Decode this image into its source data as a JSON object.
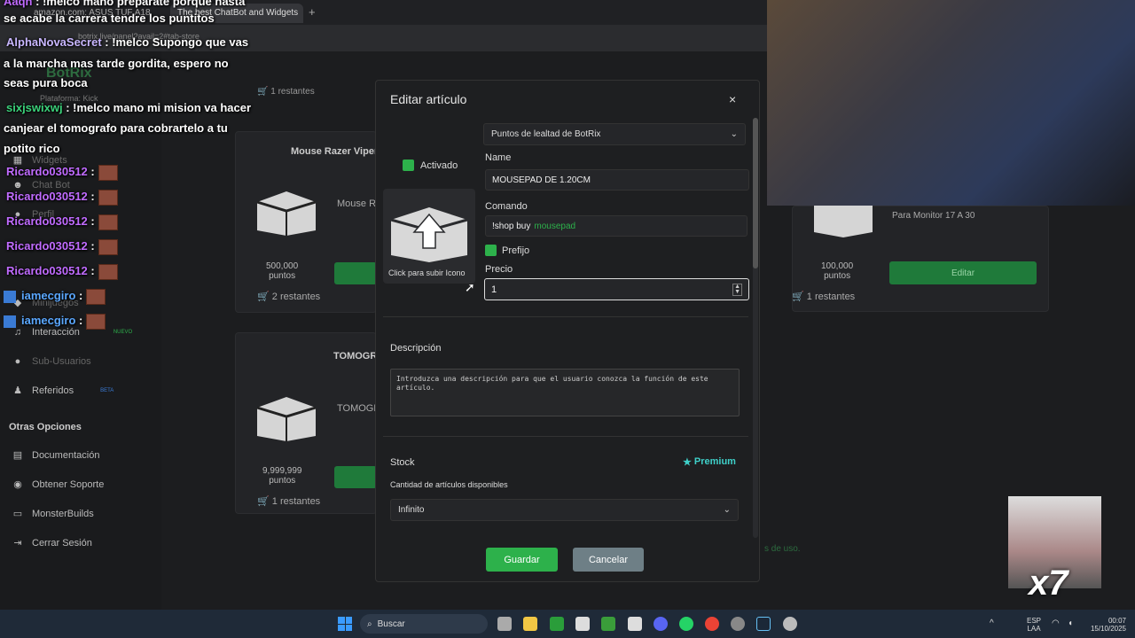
{
  "browser": {
    "tabs": [
      {
        "label": "amazon.com: ASUS TUF A18 ("
      },
      {
        "label": "The best ChatBot and Widgets"
      }
    ],
    "url": "botrix.live/panel?avail=2#tab-store"
  },
  "sidebar": {
    "brand": "BotRix",
    "platform": "Plataforma: Kick",
    "items": [
      {
        "label": "Widgets",
        "icon": "widgets-icon"
      },
      {
        "label": "Chat Bot",
        "icon": "chatbot-icon"
      },
      {
        "label": "Perfil",
        "icon": "profile-icon"
      },
      {
        "label": "Minijuegos",
        "icon": "games-icon"
      },
      {
        "label": "Interacción",
        "icon": "music-icon"
      },
      {
        "label": "Sub-Usuarios",
        "icon": "subusers-icon"
      },
      {
        "label": "Referidos",
        "icon": "referrals-icon"
      }
    ],
    "badge_new": "NUEVO",
    "badge_beta": "BETA",
    "other_heading": "Otras Opciones",
    "other_items": [
      {
        "label": "Documentación",
        "icon": "docs-icon"
      },
      {
        "label": "Obtener Soporte",
        "icon": "support-icon"
      },
      {
        "label": "MonsterBuilds",
        "icon": "monitor-icon"
      },
      {
        "label": "Cerrar Sesión",
        "icon": "logout-icon"
      }
    ]
  },
  "chat": {
    "messages": [
      {
        "user": "Aaqn",
        "text": "!melco mano preparate porque hasta"
      },
      {
        "user": "",
        "text": "se acabe la carrera tendre los puntitos"
      },
      {
        "user": "AlphaNovaSecret",
        "text": "!melco Supongo que vas"
      },
      {
        "user": "",
        "text": "a la marcha mas tarde gordita, espero no"
      },
      {
        "user": "",
        "text": "seas pura boca"
      },
      {
        "user": "sixjswixwj",
        "text": "!melco mano mi mision va hacer"
      },
      {
        "user": "",
        "text": "canjear el tomografo para cobrartelo a tu"
      },
      {
        "user": "",
        "text": "potito rico"
      },
      {
        "user": "Ricardo030512",
        "text": ":"
      },
      {
        "user": "Ricardo030512",
        "text": ":"
      },
      {
        "user": "Ricardo030512",
        "text": ":"
      },
      {
        "user": "Ricardo030512",
        "text": ":"
      },
      {
        "user": "Ricardo030512",
        "text": ":"
      },
      {
        "user": "iamecgiro",
        "text": ":"
      },
      {
        "user": "iamecgiro",
        "text": ":"
      }
    ]
  },
  "store": {
    "restantes_top": "1 restantes",
    "cards": [
      {
        "title": "Mouse Razer Viper",
        "desc": "Mouse Ra",
        "points": "500,000",
        "points_unit": "puntos",
        "remaining": "2 restantes"
      },
      {
        "title": "TOMOGRA",
        "desc": "TOMOGR",
        "points": "9,999,999",
        "points_unit": "puntos",
        "remaining": "1 restantes"
      },
      {
        "title": "",
        "desc": "Para Monitor 17 A 30",
        "points": "100,000",
        "points_unit": "puntos",
        "remaining": "1 restantes",
        "button": "Editar"
      }
    ],
    "footer_fragment": "s de uso."
  },
  "modal": {
    "title": "Editar artículo",
    "close": "×",
    "currency_select": "Puntos de lealtad de BotRix",
    "activated_label": "Activado",
    "upload_label": "Click para subir Icono",
    "name_label": "Name",
    "name_value": "MOUSEPAD DE 1.20CM",
    "command_label": "Comando",
    "command_prefix": "!shop buy",
    "command_value": "mousepad",
    "prefix_label": "Prefijo",
    "price_label": "Precio",
    "price_value": "1",
    "description_label": "Descripción",
    "description_placeholder": "Introduzca una descripción para que el usuario conozca la función de este artículo.",
    "stock_label": "Stock",
    "premium_label": "Premium",
    "stock_sub_label": "Cantidad de artículos disponibles",
    "stock_select": "Infinito",
    "save_label": "Guardar",
    "cancel_label": "Cancelar"
  },
  "taskbar": {
    "search": "Buscar",
    "lang_top": "ESP",
    "lang_bottom": "LAA",
    "time": "00:07",
    "date": "15/10/2025"
  },
  "meme": {
    "label": "x7"
  },
  "colors": {
    "accent_green": "#2db14b",
    "cancel_gray": "#6e7f86",
    "premium_teal": "#3fd0c9"
  }
}
